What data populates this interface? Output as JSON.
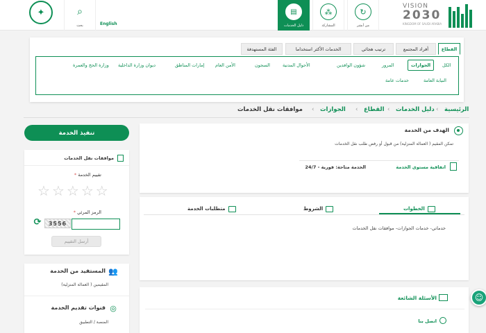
{
  "header": {
    "nav": [
      {
        "label": "بحث",
        "icon": "search-icon"
      },
      {
        "label": "دليل الخدمات",
        "icon": "book-icon"
      },
      {
        "label": "المشاركة",
        "icon": "share-icon"
      },
      {
        "label": "من أبشر",
        "icon": "refresh-icon"
      }
    ],
    "english_label": "English",
    "vision": {
      "top": "VISION",
      "year": "2030",
      "sub": "KINGDOM OF SAUDI ARABIA"
    }
  },
  "sector_tabs": [
    "القطاع",
    "أفراد المجتمع",
    "ترتيب هجائي",
    "الخدمات الأكثر استخداما",
    "الفئة المستهدفة"
  ],
  "sector_chips": [
    "الكل",
    "الجوازات",
    "المرور",
    "شؤون الوافدين",
    "الأحوال المدنية",
    "السجون",
    "الأمن العام",
    "إمارات المناطق",
    "ديوان وزارة الداخلية",
    "وزارة الحج والعمرة",
    "النيابة العامة",
    "خدمات عامة"
  ],
  "breadcrumb": [
    "الرئيسية",
    "دليل الخدمات",
    "القطاع",
    "الجوازات",
    "موافقات نقل الخدمات"
  ],
  "execute_button": "تنفيذ الخدمة",
  "rating": {
    "title": "موافقات نقل الخدمات",
    "rate_label": "تقييم الخدمة",
    "captcha_label": "الرمز المرئي",
    "captcha_text": "3556",
    "send_label": "أرسل التقييم",
    "stars_total": 5,
    "stars_filled": 0
  },
  "beneficiary": {
    "title": "المستفيد من الخدمة",
    "value": "المقيمين ( العمالة المنزلية)"
  },
  "channels": {
    "title": "قنوات تقديم الخدمة",
    "value": "المنصة / التطبيق"
  },
  "goal": {
    "title": "الهدف من الخدمة",
    "text": "تمكن المقيم ( العمالة المنزلية) من قبول أو رفض طلب نقل الخدمات",
    "sla_label": "اتفاقية مستوى الخدمة",
    "sla_value": "الخدمة متاحة: فورية - 24/7"
  },
  "steps": {
    "tabs": [
      "الخطوات",
      "الشروط",
      "متطلبات الخدمة"
    ],
    "text": "خدماتي- خدمات الجوازات- موافقات نقل الخدمات"
  },
  "faq": {
    "title": "الأسئلة الشائعة",
    "contact": "اتصل بنا"
  }
}
